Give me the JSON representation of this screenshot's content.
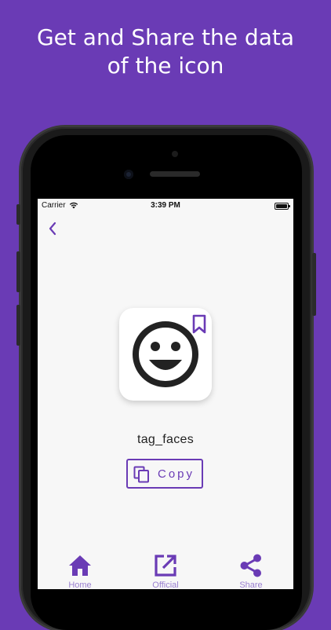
{
  "promo": {
    "line1": "Get and Share the data",
    "line2": "of the icon"
  },
  "status_bar": {
    "carrier": "Carrier",
    "time": "3:39 PM"
  },
  "detail": {
    "icon_name": "tag_faces",
    "icon": "tag-faces-icon",
    "bookmark_icon": "bookmark-icon",
    "copy_label": "Copy"
  },
  "tab_bar": {
    "home_label": "Home",
    "official_label": "Official",
    "share_label": "Share"
  },
  "colors": {
    "accent": "#6a3bb5",
    "tab_label": "#9a7fd0",
    "screen_bg": "#f7f7f7"
  }
}
